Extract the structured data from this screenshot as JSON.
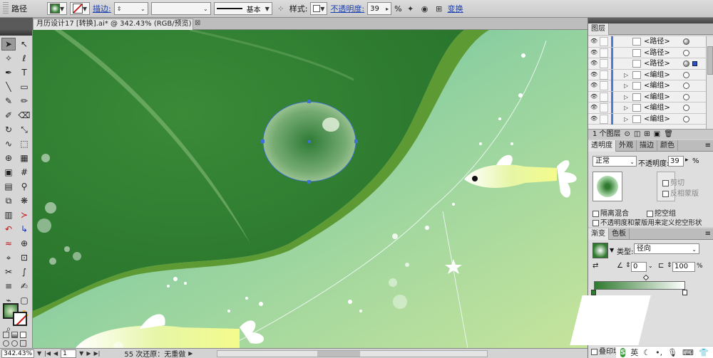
{
  "control_bar": {
    "object_type": "路径",
    "stroke_label": "描边:",
    "brush_label": "基本",
    "style_label": "样式:",
    "opacity_label": "不透明度:",
    "opacity_value": "39",
    "opacity_unit": "%",
    "transform_label": "变换"
  },
  "document_tab": {
    "title": "月历设计17 [转换].ai* @ 342.43% (RGB/预览)",
    "close": "⊠"
  },
  "status_bar": {
    "zoom": "342.43%",
    "page": "1",
    "status_text": "55 次还原：无重做"
  },
  "layers_panel": {
    "tab_label": "图层",
    "rows": [
      {
        "name": "<路径>",
        "arrow": false,
        "target_filled": true,
        "selected": false
      },
      {
        "name": "<路径>",
        "arrow": false,
        "target_filled": false,
        "selected": false
      },
      {
        "name": "<路径>",
        "arrow": false,
        "target_filled": true,
        "selected": true
      },
      {
        "name": "<编组>",
        "arrow": true,
        "target_filled": false,
        "selected": false
      },
      {
        "name": "<编组>",
        "arrow": true,
        "target_filled": false,
        "selected": false
      },
      {
        "name": "<编组>",
        "arrow": true,
        "target_filled": false,
        "selected": false
      },
      {
        "name": "<编组>",
        "arrow": true,
        "target_filled": false,
        "selected": false
      },
      {
        "name": "<编组>",
        "arrow": true,
        "target_filled": false,
        "selected": false
      }
    ],
    "footer_count": "1 个图层"
  },
  "transparency_panel": {
    "tabs": [
      "透明度",
      "外观",
      "描边",
      "颜色"
    ],
    "blend_mode": "正常",
    "opacity_label": "不透明度:",
    "opacity_value": "39",
    "opacity_unit": "%",
    "clip_label": "剪切",
    "invert_mask_label": "反相蒙版",
    "isolate_label": "隔离混合",
    "knockout_label": "挖空组",
    "opacity_mask_label": "不透明度和蒙版用来定义挖空形状"
  },
  "gradient_panel": {
    "tabs": [
      "渐变",
      "色板"
    ],
    "type_label": "类型:",
    "type_value": "径向",
    "angle_value": "0",
    "aspect_value": "100",
    "aspect_unit": "%"
  },
  "bottom_dock": {
    "overprint_label": "叠印填"
  },
  "ime": {
    "logo": "S",
    "lang": "英",
    "icons": [
      "moon-icon",
      "dot-icon",
      "mic-icon",
      "keyboard-icon",
      "shirt-icon",
      "grid-icon"
    ]
  },
  "colors": {
    "canvas_dark_green": "#2e7a2f",
    "canvas_light_green": "#bfe0a0",
    "teal": "#3aaa9c",
    "selection_blue": "#3f6fd8"
  }
}
